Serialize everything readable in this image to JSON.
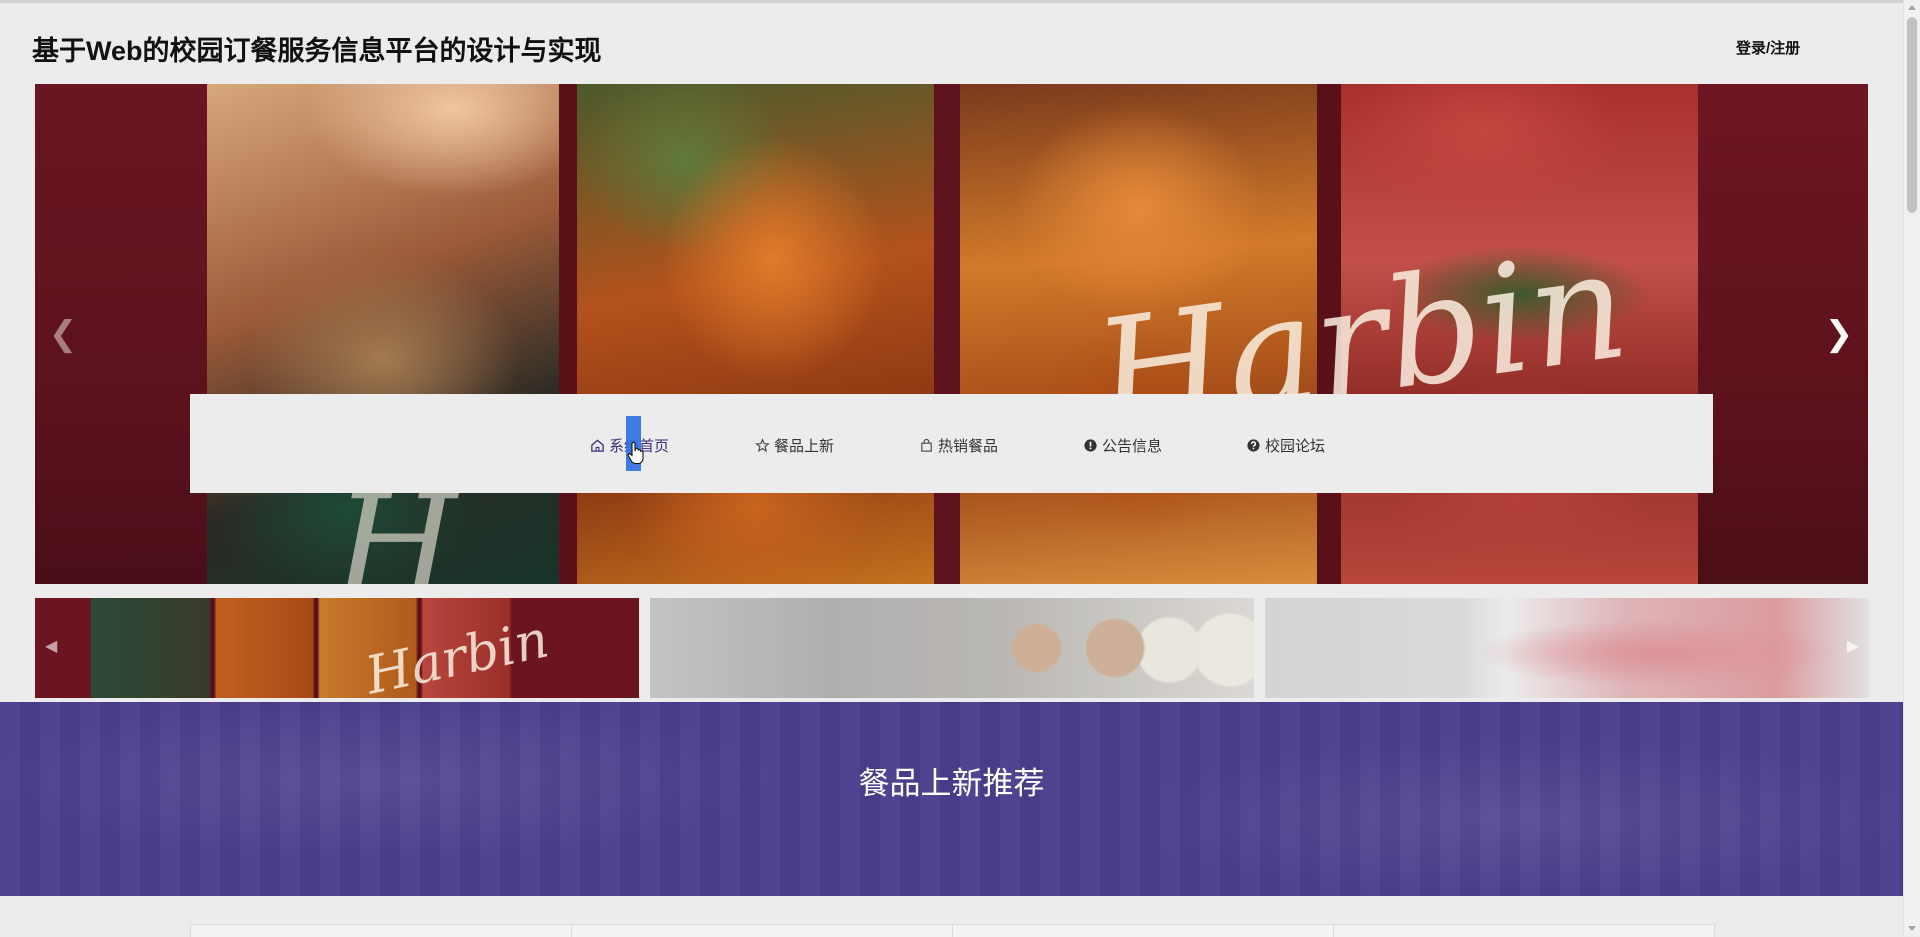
{
  "header": {
    "site_title": "基于Web的校园订餐服务信息平台的设计与实现",
    "login_label": "登录/注册"
  },
  "banner": {
    "script_text_main": "Harbin",
    "script_text_lower": "H"
  },
  "nav": {
    "items": [
      {
        "label": "系统首页",
        "icon": "home-icon"
      },
      {
        "label": "餐品上新",
        "icon": "star-icon"
      },
      {
        "label": "热销餐品",
        "icon": "bag-icon"
      },
      {
        "label": "公告信息",
        "icon": "exclamation-circle-icon"
      },
      {
        "label": "校园论坛",
        "icon": "question-circle-icon"
      }
    ],
    "active_color": "#3a2e7a"
  },
  "thumbnails": {
    "script_text": "Harbin"
  },
  "section": {
    "title": "餐品上新推荐",
    "color": "#4a3e8c"
  }
}
